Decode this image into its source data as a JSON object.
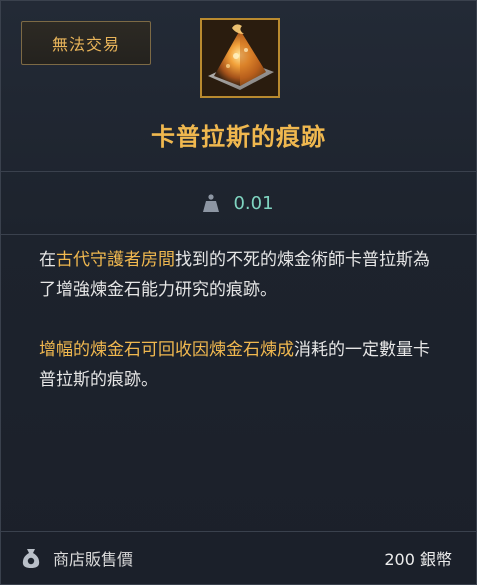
{
  "badge": {
    "label": "無法交易"
  },
  "item": {
    "name": "卡普拉斯的痕跡",
    "icon": "glowing-pyramid-stone-icon"
  },
  "weight": {
    "icon": "weight-icon",
    "value": "0.01"
  },
  "description": {
    "p1": [
      "在",
      "古代守護者房間",
      "找到的不死的煉金術師卡普拉斯為了增強煉金石能力研究的痕跡。"
    ],
    "p2": [
      "增幅的煉金石可回收因",
      "煉金石煉成",
      "消耗的一定數量卡普拉斯的痕跡。"
    ]
  },
  "footer": {
    "icon": "money-bag-icon",
    "label": "商店販售價",
    "price": "200 銀幣"
  },
  "colors": {
    "title": "#f0b84f",
    "highlight": "#f0b84f",
    "weight": "#7fd4c0",
    "badge_border": "#7d6a45"
  }
}
